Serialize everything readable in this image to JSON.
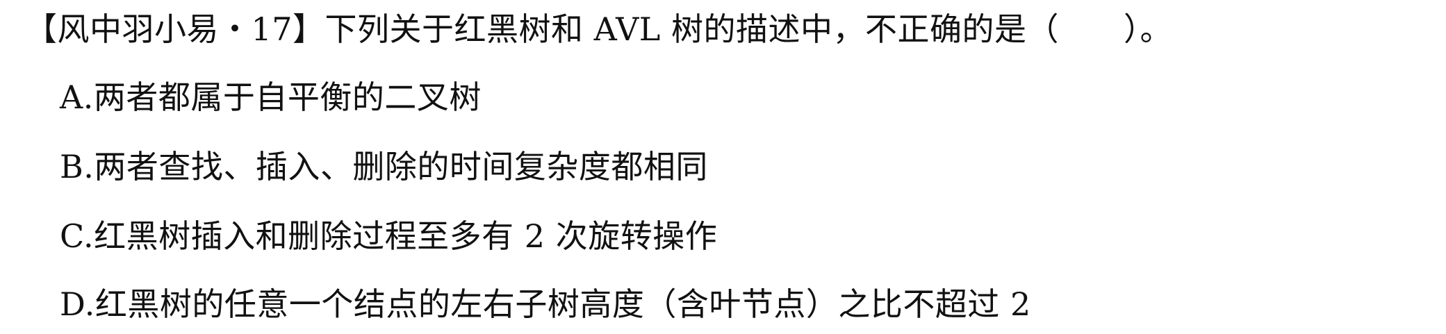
{
  "question": {
    "stem": "【风中羽小易・17】下列关于红黑树和 AVL 树的描述中，不正确的是（　　）。",
    "options": [
      {
        "text": "A.两者都属于自平衡的二叉树"
      },
      {
        "text": "B.两者查找、插入、删除的时间复杂度都相同"
      },
      {
        "text": "C.红黑树插入和删除过程至多有 2 次旋转操作"
      },
      {
        "text": "D.红黑树的任意一个结点的左右子树高度（含叶节点）之比不超过 2"
      }
    ]
  }
}
